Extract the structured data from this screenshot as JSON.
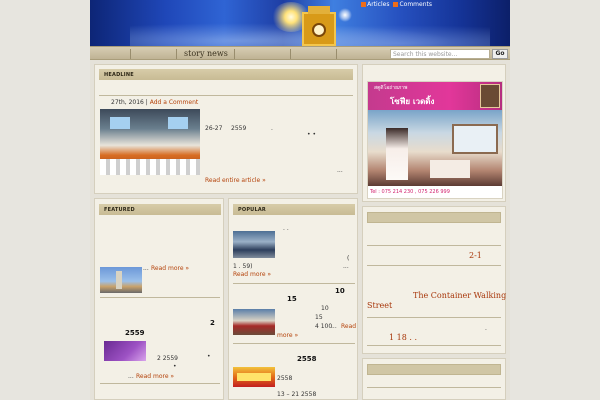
{
  "header": {
    "articles_label": "Articles",
    "comments_label": "Comments",
    "nav_item": "story news",
    "search_placeholder": "Search this website...",
    "go_label": "Go",
    "accent_orange": "#f06d1a"
  },
  "headline": {
    "title": "HEADLINE",
    "date_text": "27th, 2016 |",
    "add_comment": "Add a Comment",
    "body_line1": "26-27",
    "body_line1b": "2559",
    "body_dot1": ".",
    "body_dots": "•    •",
    "ellipsis": "...",
    "read_more": "Read entire article »"
  },
  "featured": {
    "title": "FEATURED",
    "item1_more": "Read more »",
    "item1_dots": "...",
    "item2_num": "2",
    "item2_year": "2559",
    "item2_text": "2      2559",
    "item2_star": "•",
    "item2_dot": "•",
    "item2_more": "Read more »",
    "item2_ellipsis": "..."
  },
  "popular": {
    "title": "POPULAR",
    "item1_dots": ".   .",
    "item1_paren": "(",
    "item1_line": "1    .  59)",
    "item1_ellipsis": "...",
    "item1_more": "Read more »",
    "item2_num": "10",
    "item2_num2": "15",
    "item2_a": "10",
    "item2_b": "15",
    "item2_c": "4    100",
    "item2_ellipsis": "...",
    "item2_read": "Read",
    "item2_more": "more »",
    "item3_year": "2558",
    "item3_line1": "2558",
    "item3_line2": "13 – 21          2558"
  },
  "ad": {
    "line1": "สตูดิโอถ่ายภาพ",
    "line2": "โซฟีย เวดดิ้ง",
    "phone": "Tel : 075 214 230 , 075 226 999",
    "accent": "#e2379a"
  },
  "right_box": {
    "line1": "2-1",
    "line2": "The Container Walking",
    "line3": "Street",
    "line4": "1          18  .  .",
    "line_dot": "."
  }
}
